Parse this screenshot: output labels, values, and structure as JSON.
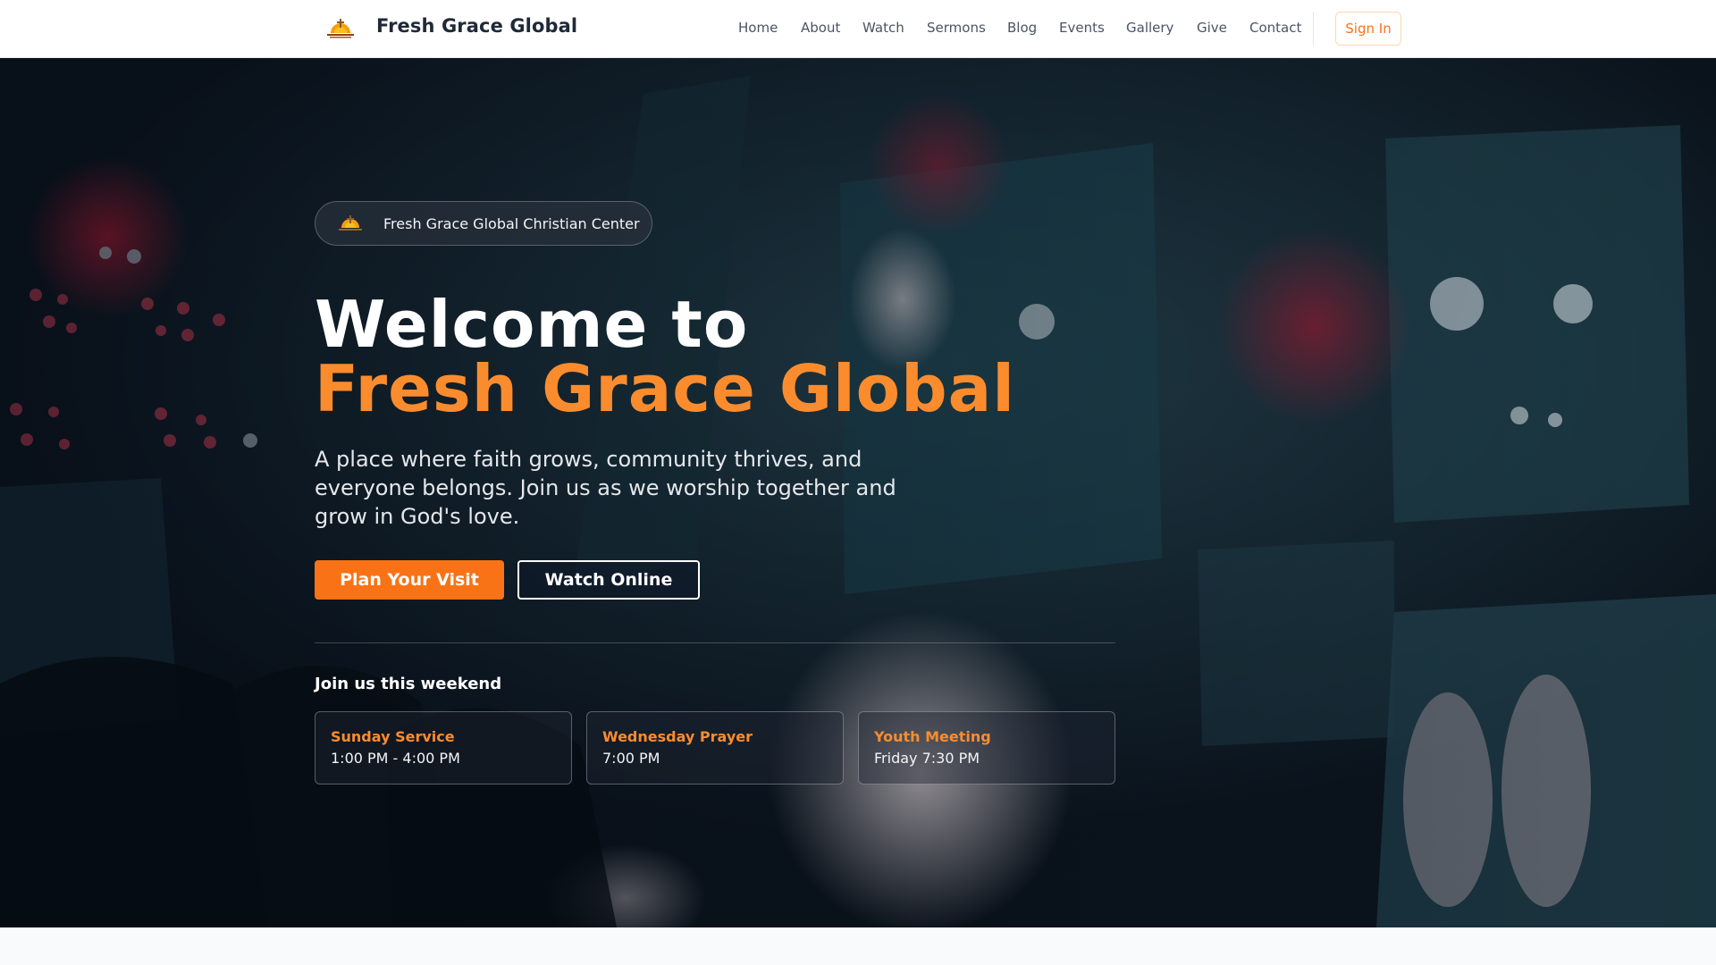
{
  "header": {
    "brand": "Fresh Grace Global",
    "nav": [
      {
        "label": "Home"
      },
      {
        "label": "About"
      },
      {
        "label": "Watch"
      },
      {
        "label": "Sermons"
      },
      {
        "label": "Blog"
      },
      {
        "label": "Events"
      },
      {
        "label": "Gallery"
      },
      {
        "label": "Give"
      },
      {
        "label": "Contact"
      }
    ],
    "signin_label": "Sign In"
  },
  "hero": {
    "badge_text": "Fresh Grace Global Christian Center",
    "title_line1": "Welcome to",
    "title_line2": "Fresh Grace Global",
    "subtitle": "A place where faith grows, community thrives, and everyone belongs. Join us as we worship together and grow in God's love.",
    "primary_cta": "Plan Your Visit",
    "secondary_cta": "Watch Online",
    "weekend_label": "Join us this weekend",
    "services": [
      {
        "name": "Sunday Service",
        "time": "1:00 PM - 4:00 PM"
      },
      {
        "name": "Wednesday Prayer",
        "time": "7:00 PM"
      },
      {
        "name": "Youth Meeting",
        "time": "Friday 7:30 PM"
      }
    ]
  },
  "colors": {
    "accent": "#f97316",
    "accent_text": "#fb8c2e",
    "header_bg": "#ffffff",
    "hero_bg": "#0d1a24"
  },
  "icons": {
    "logo": "church-logo-icon",
    "badge_logo": "church-logo-icon"
  }
}
